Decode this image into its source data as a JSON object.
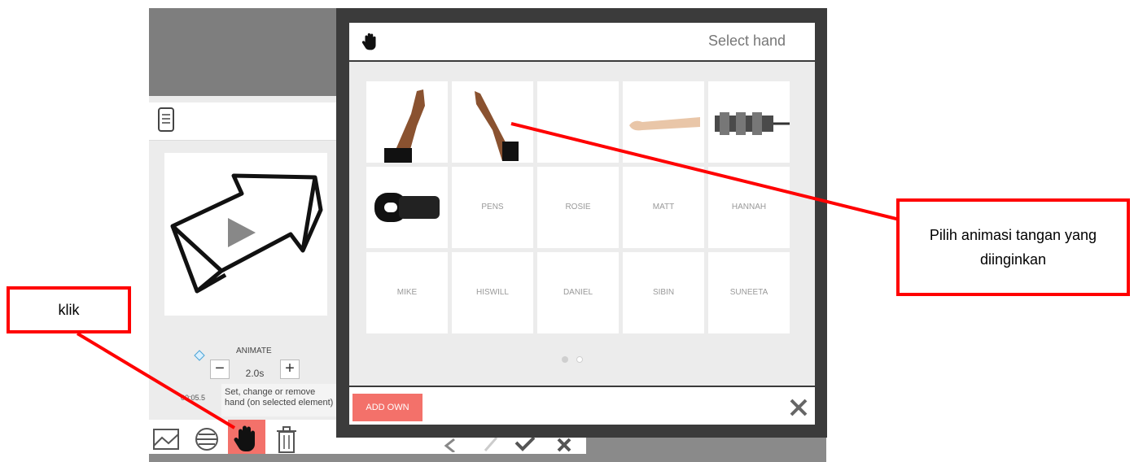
{
  "editor": {
    "animate_label": "ANIMATE",
    "duration": "2.0s",
    "decrease_label": "−",
    "increase_label": "+",
    "timecode": "00:05.5",
    "tooltip": "Set, change or remove hand (on selected element)"
  },
  "toolbar": {
    "icons": [
      "image-icon",
      "text-icon",
      "hand-icon",
      "trash-icon"
    ],
    "nav_icons": [
      "chevron-left-icon",
      "pen-icon",
      "check-icon",
      "close-icon"
    ]
  },
  "dialog": {
    "title": "Select hand",
    "hands": [
      {
        "label": "",
        "image": "hand-right-arm"
      },
      {
        "label": "",
        "image": "hand-left-arm"
      },
      {
        "label": "",
        "image": "empty"
      },
      {
        "label": "",
        "image": "arm-horizontal"
      },
      {
        "label": "",
        "image": "robot-hand"
      },
      {
        "label": "",
        "image": "zipper"
      },
      {
        "label": "PENS",
        "image": ""
      },
      {
        "label": "ROSIE",
        "image": ""
      },
      {
        "label": "MATT",
        "image": ""
      },
      {
        "label": "HANNAH",
        "image": ""
      },
      {
        "label": "MIKE",
        "image": ""
      },
      {
        "label": "HISWILL",
        "image": ""
      },
      {
        "label": "DANIEL",
        "image": ""
      },
      {
        "label": "SIBIN",
        "image": ""
      },
      {
        "label": "SUNEETA",
        "image": ""
      }
    ],
    "page_dots": [
      true,
      false
    ],
    "add_own_label": "ADD OWN"
  },
  "annotations": {
    "klik": "klik",
    "pilih": "Pilih animasi tangan yang diinginkan"
  },
  "colors": {
    "accent": "#f3716a",
    "annotation": "#ff0000"
  }
}
